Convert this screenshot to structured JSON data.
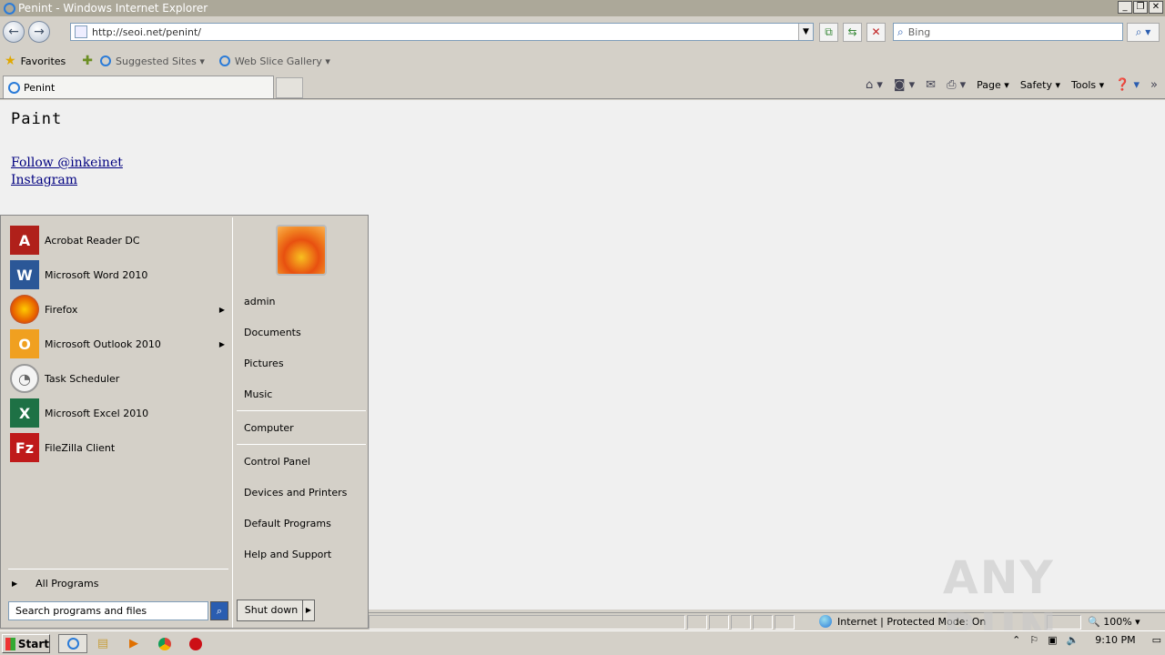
{
  "window": {
    "title": "Penint - Windows Internet Explorer"
  },
  "address": {
    "url": "http://seoi.net/penint/"
  },
  "search": {
    "placeholder": "Bing"
  },
  "favorites_bar": {
    "favorites_label": "Favorites",
    "links": [
      "Suggested Sites",
      "Web Slice Gallery"
    ]
  },
  "tab": {
    "title": "Penint"
  },
  "command_bar": {
    "page": "Page",
    "safety": "Safety",
    "tools": "Tools"
  },
  "page": {
    "heading": "Paint",
    "links": [
      "Follow @inkeinet",
      "Instagram"
    ]
  },
  "start_menu": {
    "programs": [
      {
        "label": "Acrobat Reader DC",
        "icon": "acrobat-icon",
        "submenu": false
      },
      {
        "label": "Microsoft Word 2010",
        "icon": "word-icon",
        "submenu": false
      },
      {
        "label": "Firefox",
        "icon": "firefox-icon",
        "submenu": true
      },
      {
        "label": "Microsoft Outlook 2010",
        "icon": "outlook-icon",
        "submenu": true
      },
      {
        "label": "Task Scheduler",
        "icon": "clock-icon",
        "submenu": false
      },
      {
        "label": "Microsoft Excel 2010",
        "icon": "excel-icon",
        "submenu": false
      },
      {
        "label": "FileZilla Client",
        "icon": "filezilla-icon",
        "submenu": false
      }
    ],
    "all_programs": "All Programs",
    "search_placeholder": "Search programs and files",
    "right_items": [
      "admin",
      "Documents",
      "Pictures",
      "Music",
      "Computer",
      "Control Panel",
      "Devices and Printers",
      "Default Programs",
      "Help and Support"
    ],
    "shutdown_label": "Shut down"
  },
  "status_bar": {
    "zone": "Internet | Protected Mode: On",
    "zoom": "100%"
  },
  "taskbar": {
    "start_label": "Start",
    "clock": "9:10 PM"
  },
  "watermark": "ANY RUN"
}
